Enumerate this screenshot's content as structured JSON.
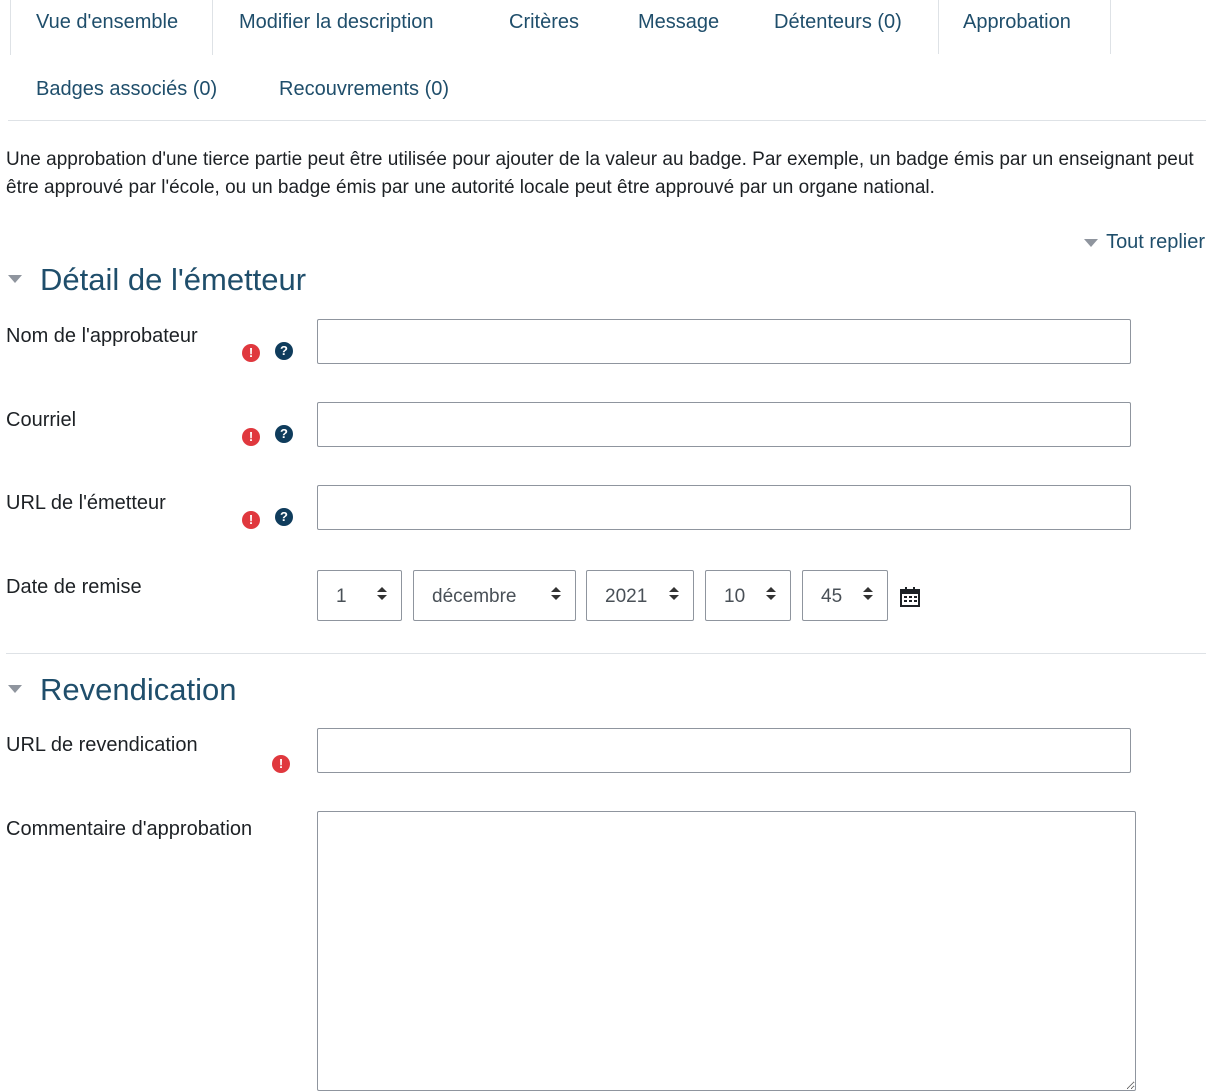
{
  "tabs": [
    {
      "label": "Vue d'ensemble",
      "active": true
    },
    {
      "label": "Modifier la description",
      "active": false
    },
    {
      "label": "Critères",
      "active": false
    },
    {
      "label": "Message",
      "active": false
    },
    {
      "label": "Détenteurs (0)",
      "active": false
    },
    {
      "label": "Approbation",
      "active": false
    },
    {
      "label": "Badges associés (0)",
      "active": false
    },
    {
      "label": "Recouvrements (0)",
      "active": false
    }
  ],
  "intro_text": "Une approbation d'une tierce partie peut être utilisée pour ajouter de la valeur au badge. Par exemple, un badge émis par un enseignant peut être approuvé par l'école, ou un badge émis par une autorité locale peut être approuvé par un organe national.",
  "collapse_all_label": "Tout replier",
  "issuer_section": {
    "title": "Détail de l'émetteur",
    "fields": {
      "issuer_name": {
        "label": "Nom de l'approbateur",
        "value": "",
        "required": true,
        "help": true
      },
      "email": {
        "label": "Courriel",
        "value": "",
        "required": true,
        "help": true
      },
      "issuer_url": {
        "label": "URL de l'émetteur",
        "value": "",
        "required": true,
        "help": true
      }
    },
    "date": {
      "label": "Date de remise",
      "day": "1",
      "month": "décembre",
      "year": "2021",
      "hour": "10",
      "minute": "45"
    }
  },
  "claim_section": {
    "title": "Revendication",
    "claim_url": {
      "label": "URL de revendication",
      "value": "",
      "required": true
    },
    "comment": {
      "label": "Commentaire d'approbation",
      "value": ""
    }
  },
  "colors": {
    "link": "#1f4e6b",
    "required_icon": "#e0383e",
    "help_icon": "#0f3c5c",
    "border": "#8f959e"
  },
  "icons": {
    "required": "exclamation-circle-icon",
    "help": "question-circle-icon",
    "calendar": "calendar-icon",
    "caret": "caret-down-icon"
  }
}
